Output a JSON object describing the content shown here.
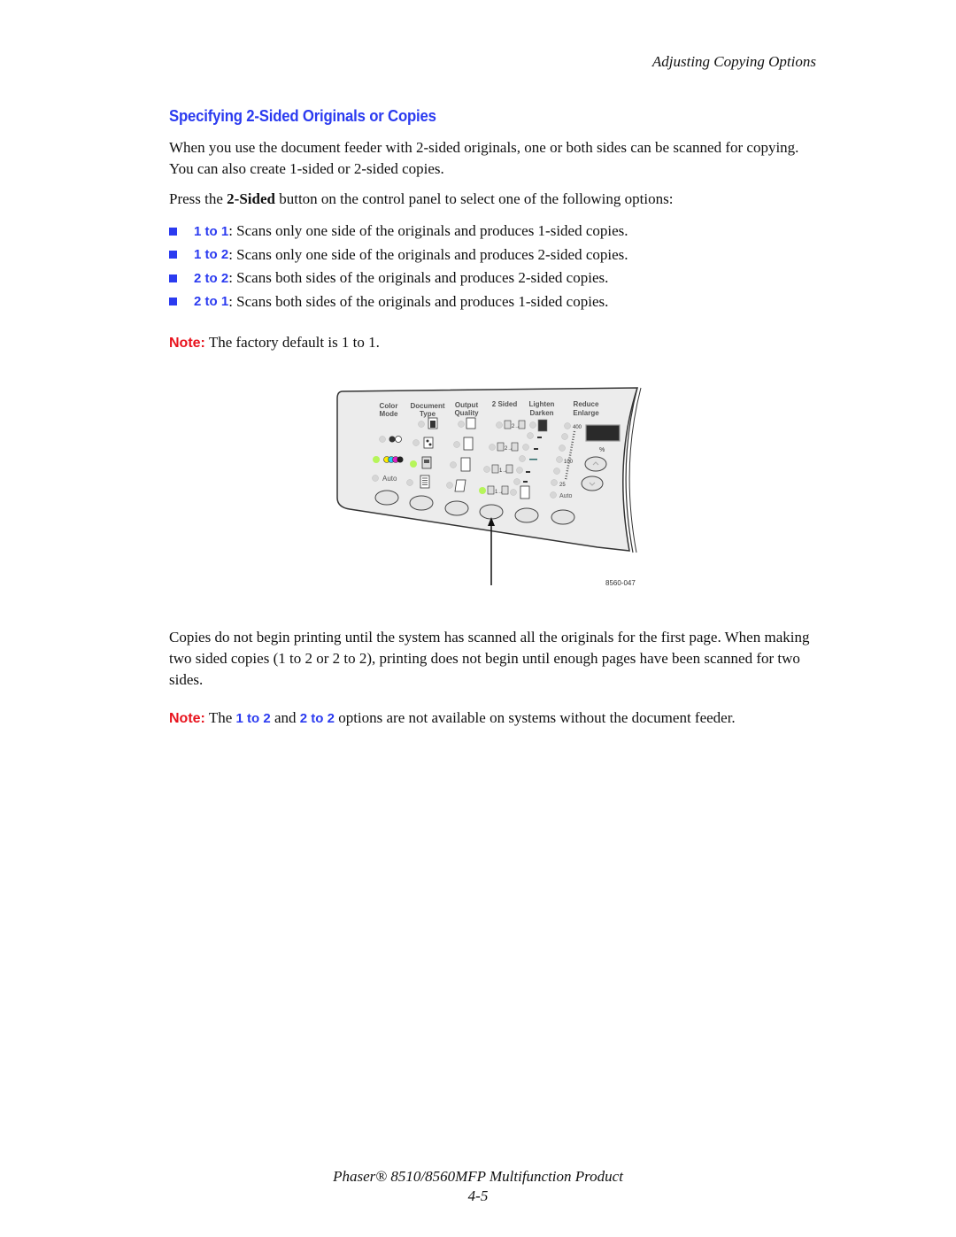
{
  "header": {
    "running_head": "Adjusting Copying Options"
  },
  "section": {
    "title": "Specifying 2-Sided Originals or Copies",
    "intro": "When you use the document feeder with 2-sided originals, one or both sides can be scanned for copying. You can also create 1-sided or 2-sided copies.",
    "instruction_prefix": "Press the ",
    "instruction_bold": "2-Sided",
    "instruction_suffix": " button on the control panel to select one of the following options:",
    "options": [
      {
        "label": "1 to 1",
        "description": ": Scans only one side of the originals and produces 1-sided copies."
      },
      {
        "label": "1 to 2",
        "description": ": Scans only one side of the originals and produces 2-sided copies."
      },
      {
        "label": "2 to 2",
        "description": ": Scans both sides of the originals and produces 2-sided copies."
      },
      {
        "label": "2 to 1",
        "description": ": Scans both sides of the originals and produces 1-sided copies."
      }
    ],
    "note1": {
      "label": "Note:",
      "text": " The factory default is 1 to 1."
    },
    "body_after_figure": "Copies do not begin printing until the system has scanned all the originals for the first page. When making two sided copies (1 to 2 or 2 to 2), printing does not begin until enough pages have been scanned for two sides.",
    "note2": {
      "label": "Note:",
      "t1": " The ",
      "opt1": "1 to 2",
      "t2": " and ",
      "opt2": "2 to 2",
      "t3": " options are not available on systems without the document feeder."
    }
  },
  "figure": {
    "id": "8560-047",
    "panel_labels": {
      "color_mode": [
        "Color",
        "Mode"
      ],
      "document_type": [
        "Document",
        "Type"
      ],
      "output_quality": [
        "Output",
        "Quality"
      ],
      "two_sided": [
        "2 Sided"
      ],
      "lighten_darken": [
        "Lighten",
        "Darken"
      ],
      "reduce_enlarge": [
        "Reduce",
        "Enlarge"
      ]
    },
    "auto_label": "Auto",
    "percent_label": "%",
    "scale_values": [
      "400",
      "100",
      "25"
    ],
    "two_sided_options": [
      "2 to 1",
      "2 to 2",
      "1 to 2",
      "1 to 1"
    ],
    "selected_two_sided": "1 to 1",
    "colors": {
      "led_on": "#b6f55a",
      "led_off": "#d6d6d6",
      "panel": "#ececec",
      "display": "#2a2a2a"
    }
  },
  "footer": {
    "product": "Phaser® 8510/8560MFP Multifunction Product",
    "page": "4-5"
  },
  "colors": {
    "heading": "#2b3bf0",
    "note": "#e8141e",
    "option": "#2b3bf0"
  }
}
